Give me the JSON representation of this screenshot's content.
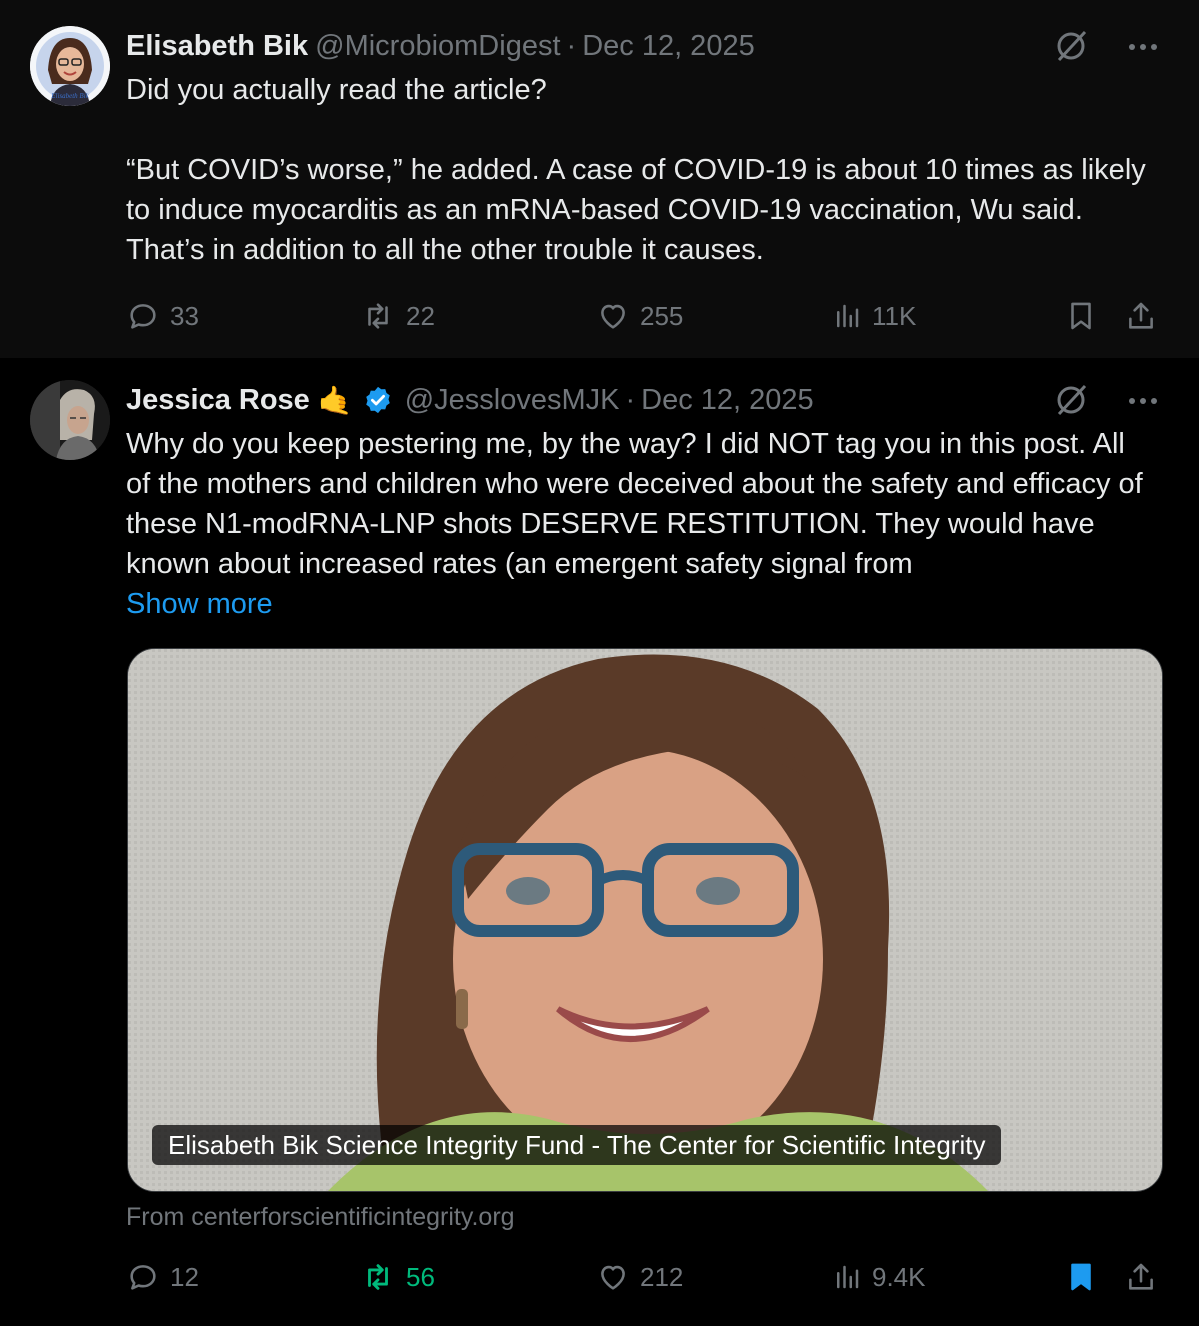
{
  "tweet1": {
    "name": "Elisabeth Bik",
    "handle": "@MicrobiomDigest",
    "separator": "·",
    "date": "Dec 12, 2025",
    "text_line1": "Did you actually read the article?",
    "text_quote": "“But COVID’s worse,” he added. A case of COVID-19 is about 10 times as likely to induce myocarditis as an mRNA-based COVID-19 vaccination, Wu said. That’s in addition to all the other trouble it causes.",
    "replies": "33",
    "reposts": "22",
    "likes": "255",
    "views": "11K",
    "bookmarked": false
  },
  "tweet2": {
    "name": "Jessica Rose",
    "emoji": "🤙",
    "handle": "@JesslovesMJK",
    "separator": "·",
    "date": "Dec 12, 2025",
    "text": "Why do you keep pestering me, by the way? I did NOT tag you in this post. All of the mothers and children who were deceived about the safety and efficacy of these N1-modRNA-LNP shots DESERVE RESTITUTION. They would have known about increased rates (an emergent safety signal from",
    "show_more": "Show more",
    "card_title": "Elisabeth Bik Science Integrity Fund - The Center for Scientific Integrity",
    "card_source": "From centerforscientificintegrity.org",
    "replies": "12",
    "reposts": "56",
    "likes": "212",
    "views": "9.4K",
    "bookmarked": true,
    "reposted": true
  },
  "colors": {
    "background": "#000000",
    "text": "#e7e9ea",
    "muted": "#71767b",
    "accent_blue": "#1d9bf0",
    "repost_green": "#00ba7c",
    "thread_line": "#333639"
  },
  "icons": [
    "grok-slash-icon",
    "more-icon",
    "reply-icon",
    "repost-icon",
    "like-icon",
    "views-icon",
    "bookmark-icon",
    "share-icon",
    "verified-badge-icon"
  ]
}
